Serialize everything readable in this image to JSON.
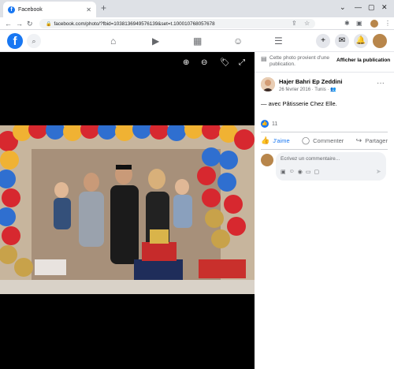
{
  "browser": {
    "tab_title": "Facebook",
    "tab_favicon": "f",
    "url": "facebook.com/photo/?fbid=1038136949576139&set=t.100010768057678",
    "colors": {
      "chrome_bg": "#dee1e6",
      "omnibox_bg": "#f1f3f4"
    }
  },
  "fbnav": {
    "logo": "f",
    "icons": [
      "search-icon",
      "home-icon",
      "watch-icon",
      "marketplace-icon",
      "groups-icon",
      "menu-icon",
      "create-icon",
      "messenger-icon",
      "notifications-icon",
      "account-icon"
    ],
    "brand_color": "#1877f2"
  },
  "viewer": {
    "tools": [
      "zoom-in-icon",
      "zoom-out-icon",
      "tag-icon",
      "fullscreen-icon"
    ]
  },
  "panel": {
    "notice_text": "Cette photo provient d'une publication.",
    "notice_link": "Afficher la publication",
    "author": "Hajer Bahri Ep Zeddini",
    "post_date": "26 février 2016 · Tunis · ",
    "post_with_prefix": "— avec ",
    "post_with_page": "Pâtisserie Chez Elle",
    "post_with_suffix": ".",
    "like_count": "11",
    "actions": {
      "like": "J'aime",
      "comment": "Commenter",
      "share": "Partager"
    },
    "comment_placeholder": "Écrivez un commentaire..."
  }
}
